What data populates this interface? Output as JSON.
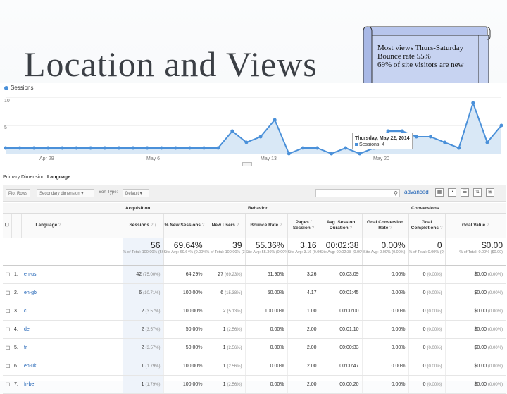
{
  "slide": {
    "title": "Location and Views"
  },
  "note": {
    "lines": [
      "Most views Thurs-Saturday",
      "Bounce rate 55%",
      "69% of site visitors are new"
    ]
  },
  "chart": {
    "legend": "Sessions",
    "y_ticks": [
      "10",
      "5"
    ],
    "x_ticks": [
      "Apr 29",
      "May 6",
      "May 13",
      "May 20"
    ],
    "tooltip": {
      "date": "Thursday, May 22, 2014",
      "series": "Sessions",
      "value": "4"
    }
  },
  "chart_data": {
    "type": "area",
    "series": [
      {
        "name": "Sessions",
        "values": [
          1,
          1,
          1,
          1,
          1,
          1,
          1,
          1,
          1,
          1,
          1,
          1,
          1,
          1,
          1,
          1,
          4,
          2,
          3,
          6,
          0,
          1,
          1,
          0,
          1,
          0,
          1,
          4,
          4,
          3,
          3,
          2,
          1,
          9,
          2,
          5
        ]
      }
    ],
    "ylim": [
      0,
      10
    ],
    "grid": true,
    "color": "#4a90d9"
  },
  "panel": {
    "dimension_label": "Primary Dimension:",
    "dimension_value": "Language",
    "toolbar": {
      "plot_rows": "Plot Rows",
      "secondary": "Secondary dimension",
      "sort_label": "Sort Type:",
      "sort_value": "Default",
      "advanced": "advanced"
    },
    "groups": {
      "acquisition": "Acquisition",
      "behavior": "Behavior",
      "conversions": "Conversions"
    },
    "headers": [
      "Language",
      "Sessions",
      "% New Sessions",
      "New Users",
      "Bounce Rate",
      "Pages / Session",
      "Avg. Session Duration",
      "Goal Conversion Rate",
      "Goal Completions",
      "Goal Value"
    ],
    "totals": [
      {
        "big": "56",
        "sub": "% of Total: 100.00% (56)"
      },
      {
        "big": "69.64%",
        "sub": "Site Avg: 69.64% (0.00%)"
      },
      {
        "big": "39",
        "sub": "% of Total: 100.00% (39)"
      },
      {
        "big": "55.36%",
        "sub": "Site Avg: 55.36% (0.00%)"
      },
      {
        "big": "3.16",
        "sub": "Site Avg: 3.16 (0.00%)"
      },
      {
        "big": "00:02:38",
        "sub": "Site Avg: 00:02:38 (0.00%)"
      },
      {
        "big": "0.00%",
        "sub": "Site Avg: 0.00% (0.00%)"
      },
      {
        "big": "0",
        "sub": "% of Total: 0.00% (0)"
      },
      {
        "big": "$0.00",
        "sub": "% of Total: 0.00% ($0.00)"
      }
    ],
    "rows": [
      {
        "n": "1.",
        "lang": "en-us",
        "s": "42",
        "sp": "(75.00%)",
        "ns": "64.29%",
        "nu": "27",
        "nup": "(69.23%)",
        "br": "61.90%",
        "ps": "3.26",
        "dur": "00:03:09",
        "gcr": "0.00%",
        "gc": "0",
        "gcp": "(0.00%)",
        "gv": "$0.00",
        "gvp": "(0.00%)"
      },
      {
        "n": "2.",
        "lang": "en-gb",
        "s": "6",
        "sp": "(10.71%)",
        "ns": "100.00%",
        "nu": "6",
        "nup": "(15.38%)",
        "br": "50.00%",
        "ps": "4.17",
        "dur": "00:01:45",
        "gcr": "0.00%",
        "gc": "0",
        "gcp": "(0.00%)",
        "gv": "$0.00",
        "gvp": "(0.00%)"
      },
      {
        "n": "3.",
        "lang": "c",
        "s": "2",
        "sp": "(3.57%)",
        "ns": "100.00%",
        "nu": "2",
        "nup": "(5.13%)",
        "br": "100.00%",
        "ps": "1.00",
        "dur": "00:00:00",
        "gcr": "0.00%",
        "gc": "0",
        "gcp": "(0.00%)",
        "gv": "$0.00",
        "gvp": "(0.00%)"
      },
      {
        "n": "4.",
        "lang": "de",
        "s": "2",
        "sp": "(3.57%)",
        "ns": "50.00%",
        "nu": "1",
        "nup": "(2.56%)",
        "br": "0.00%",
        "ps": "2.00",
        "dur": "00:01:10",
        "gcr": "0.00%",
        "gc": "0",
        "gcp": "(0.00%)",
        "gv": "$0.00",
        "gvp": "(0.00%)"
      },
      {
        "n": "5.",
        "lang": "fr",
        "s": "2",
        "sp": "(3.57%)",
        "ns": "50.00%",
        "nu": "1",
        "nup": "(2.56%)",
        "br": "0.00%",
        "ps": "2.00",
        "dur": "00:00:33",
        "gcr": "0.00%",
        "gc": "0",
        "gcp": "(0.00%)",
        "gv": "$0.00",
        "gvp": "(0.00%)"
      },
      {
        "n": "6.",
        "lang": "en-uk",
        "s": "1",
        "sp": "(1.79%)",
        "ns": "100.00%",
        "nu": "1",
        "nup": "(2.56%)",
        "br": "0.00%",
        "ps": "2.00",
        "dur": "00:00:47",
        "gcr": "0.00%",
        "gc": "0",
        "gcp": "(0.00%)",
        "gv": "$0.00",
        "gvp": "(0.00%)"
      },
      {
        "n": "7.",
        "lang": "fr-be",
        "s": "1",
        "sp": "(1.79%)",
        "ns": "100.00%",
        "nu": "1",
        "nup": "(2.56%)",
        "br": "0.00%",
        "ps": "2.00",
        "dur": "00:00:20",
        "gcr": "0.00%",
        "gc": "0",
        "gcp": "(0.00%)",
        "gv": "$0.00",
        "gvp": "(0.00%)"
      }
    ]
  }
}
